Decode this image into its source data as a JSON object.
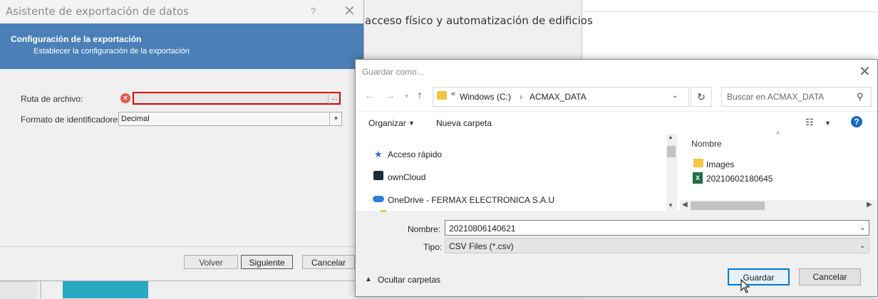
{
  "background": {
    "text": "acceso físico y automatización de edificios"
  },
  "wizard": {
    "title": "Asistente de exportación de datos",
    "help": "?",
    "close": "✕",
    "banner": {
      "title": "Configuración de la exportación",
      "subtitle": "Establecer la configuración de la exportación"
    },
    "ruta_label": "Ruta de archivo:",
    "ruta_value": "",
    "browse": "...",
    "formato_label": "Formato de identificadores:",
    "formato_value": "Decimal",
    "buttons": {
      "back": "Volver",
      "next": "Siguiente",
      "cancel": "Cancelar"
    }
  },
  "save_dialog": {
    "title": "Guardar como...",
    "close": "✕",
    "address": {
      "chevrons": "«",
      "crumb1": "Windows  (C:)",
      "separator": "›",
      "crumb2": "ACMAX_DATA"
    },
    "search_placeholder": "Buscar en ACMAX_DATA",
    "toolbar": {
      "organize": "Organizar",
      "new_folder": "Nueva carpeta"
    },
    "nav_items": [
      {
        "label": "Acceso rápido",
        "icon": "star-pin-icon"
      },
      {
        "label": "ownCloud",
        "icon": "owncloud-icon"
      },
      {
        "label": "OneDrive - FERMAX ELECTRONICA S.A.U",
        "icon": "onedrive-cloud-icon"
      }
    ],
    "column_header": "Nombre",
    "files": [
      {
        "name": "Images",
        "icon": "folder-icon"
      },
      {
        "name": "20210602180645",
        "icon": "excel-file-icon"
      }
    ],
    "nombre_label": "Nombre:",
    "nombre_value": "20210806140621",
    "tipo_label": "Tipo:",
    "tipo_value": "CSV Files (*.csv)",
    "hide_folders": "Ocultar carpetas",
    "buttons": {
      "save": "Guardar",
      "cancel": "Cancelar"
    }
  },
  "colors": {
    "banner": "#4a80b7",
    "error": "#e00000",
    "accent": "#0078d7"
  }
}
